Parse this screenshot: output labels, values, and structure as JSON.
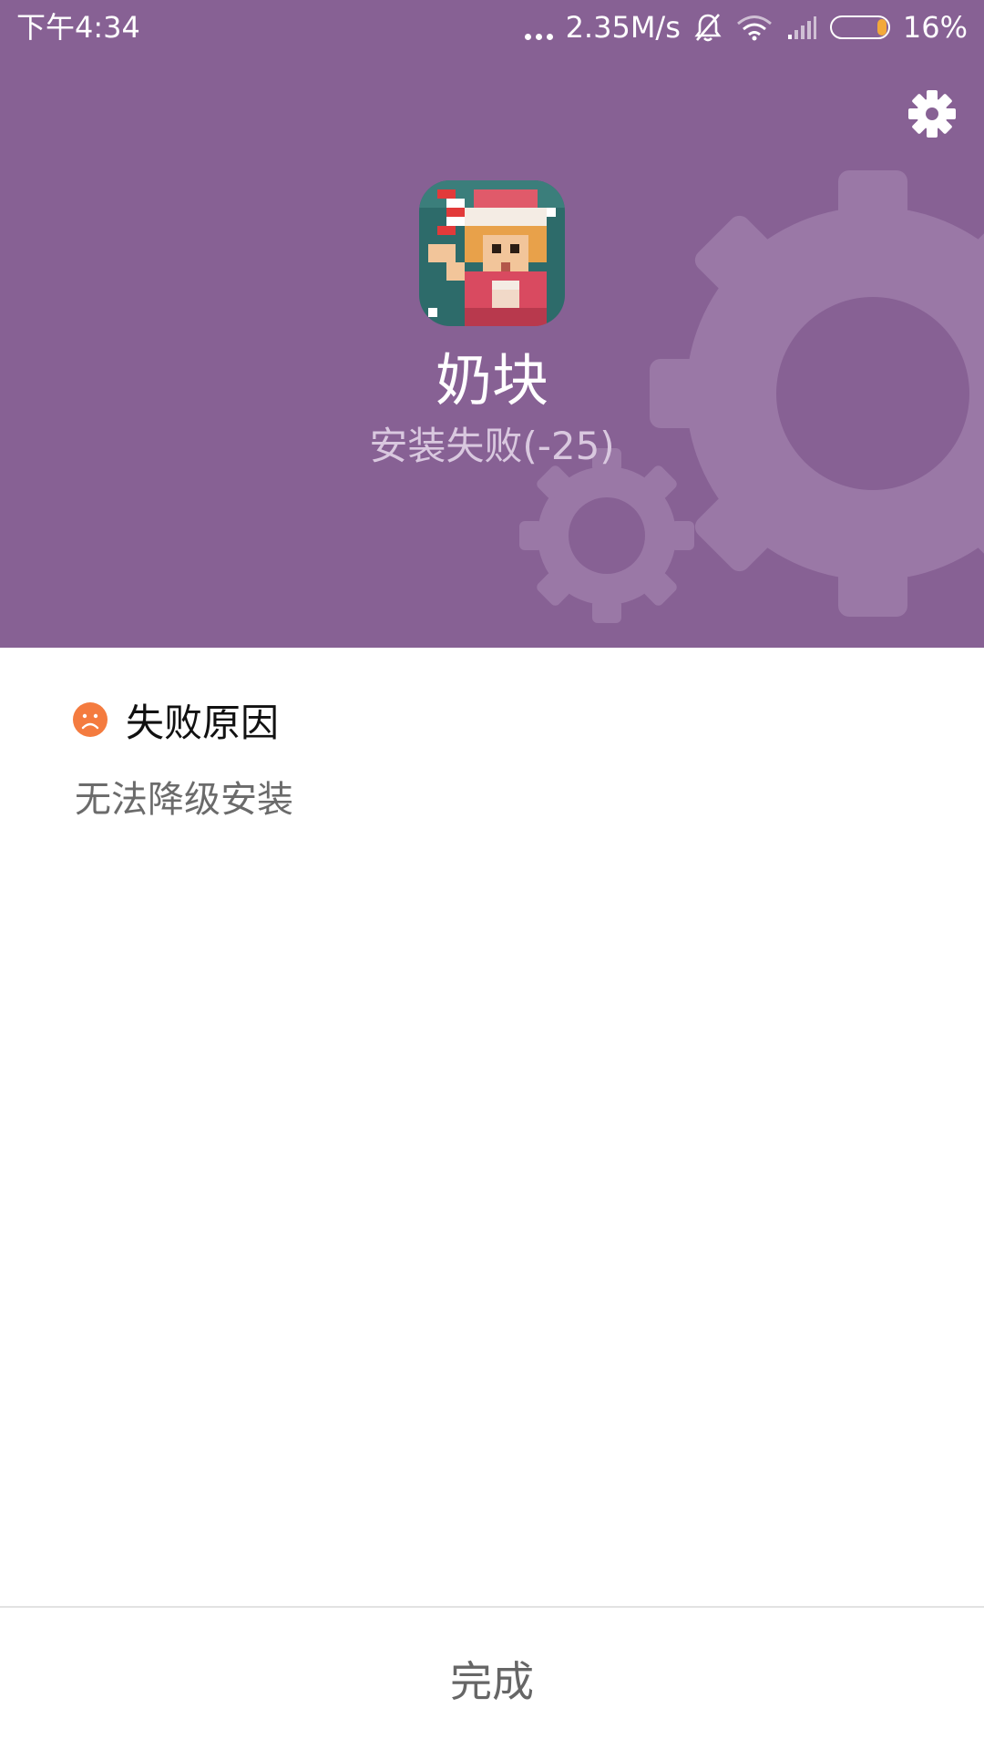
{
  "status_bar": {
    "time": "下午4:34",
    "network_speed": "2.35M/s",
    "battery_percent": "16%",
    "battery_level": 0.16,
    "icons": [
      "more-dots-icon",
      "bell-muted-icon",
      "wifi-icon",
      "signal-icon",
      "battery-icon"
    ]
  },
  "header": {
    "background_color": "#876194",
    "settings_icon": "gear-icon",
    "app_name": "奶块",
    "install_status": "安装失败(-25)"
  },
  "failure": {
    "icon": "sad-face-icon",
    "icon_color": "#f47b3f",
    "title": "失败原因",
    "reason": "无法降级安装"
  },
  "footer": {
    "done_label": "完成"
  }
}
